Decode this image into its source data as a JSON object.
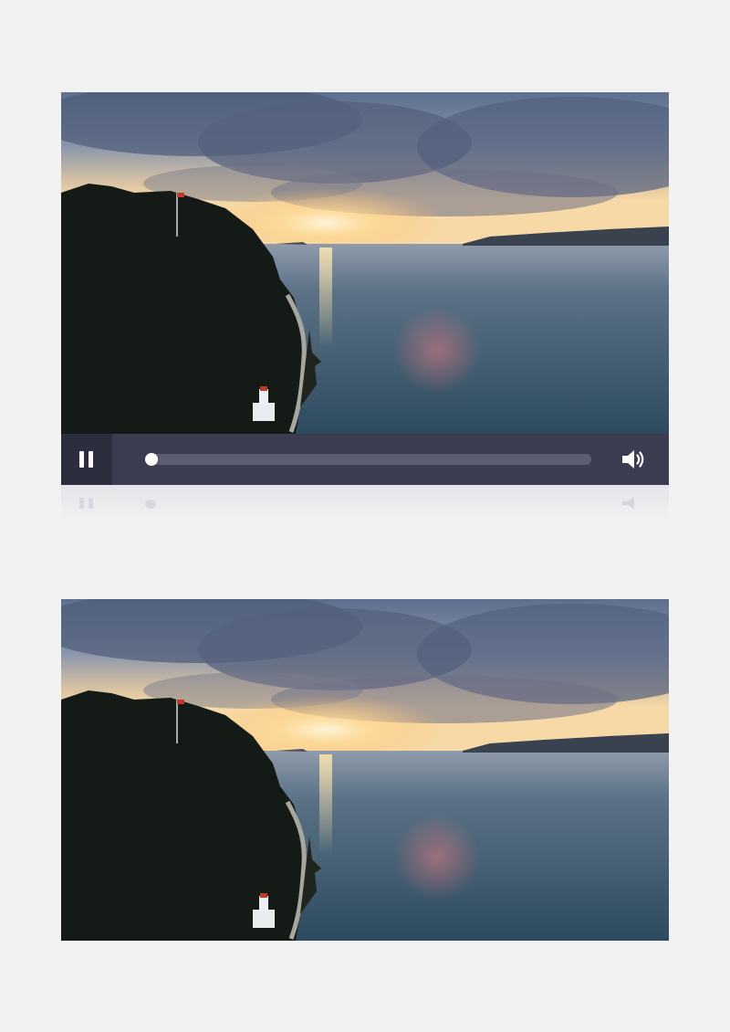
{
  "player": {
    "state": "playing",
    "progress": 0.0,
    "controls": {
      "pause_icon": "pause-icon",
      "volume_icon": "volume-icon"
    },
    "colors": {
      "control_bar": "#3b3c50",
      "play_button_bg": "#2c2d3d",
      "track": "#5c5d73",
      "knob": "#ffffff"
    }
  },
  "frames": [
    {
      "scene": "aerial-sunset-coast"
    },
    {
      "scene": "aerial-sunset-coast"
    }
  ]
}
